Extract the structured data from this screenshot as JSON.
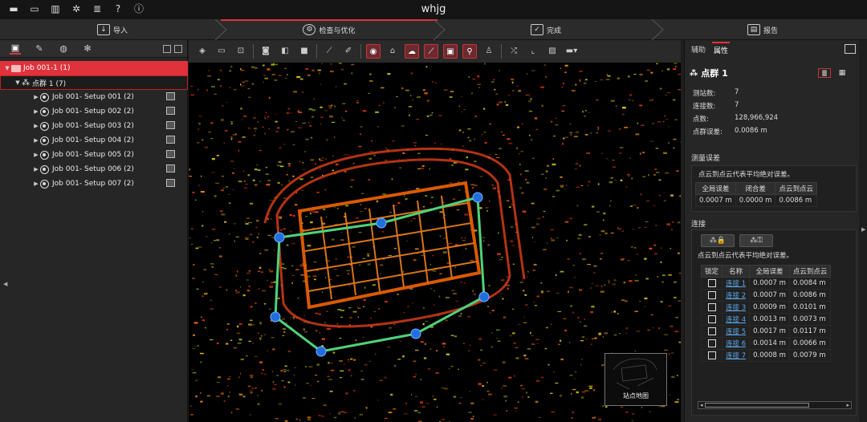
{
  "app": {
    "title": "whjg"
  },
  "titlebar_icons": [
    "folder-icon",
    "archive-icon",
    "panel-icon",
    "gear-icon",
    "database-icon",
    "help-icon",
    "info-icon"
  ],
  "workflow": {
    "steps": [
      {
        "label": "导入",
        "icon": "import-icon"
      },
      {
        "label": "检查与优化",
        "icon": "inspect-icon",
        "active": true
      },
      {
        "label": "完成",
        "icon": "finish-icon"
      },
      {
        "label": "报告",
        "icon": "report-icon"
      }
    ]
  },
  "tree": {
    "job": "Job 001-1 (1)",
    "cloud": "点群 1 (7)",
    "setups": [
      "Job 001- Setup 001 (2)",
      "Job 001- Setup 002 (2)",
      "Job 001- Setup 003 (2)",
      "Job 001- Setup 004 (2)",
      "Job 001- Setup 005 (2)",
      "Job 001- Setup 006 (2)",
      "Job 001- Setup 007 (2)"
    ]
  },
  "minimap": {
    "label": "站点地图"
  },
  "right_panel": {
    "tabs": [
      "辅助",
      "属性"
    ],
    "header": "点群 1",
    "stats": [
      {
        "k": "测站数:",
        "v": "7"
      },
      {
        "k": "连接数:",
        "v": "7"
      },
      {
        "k": "点数:",
        "v": "128,966,924"
      },
      {
        "k": "点群误差:",
        "v": "0.0086 m"
      }
    ],
    "measure_section": "测量误差",
    "measure_note": "点云到点云代表平均绝对误差。",
    "measure_headers": [
      "全局误差",
      "闭合差",
      "点云到点云"
    ],
    "measure_values": [
      "0.0007 m",
      "0.0000 m",
      "0.0086 m"
    ],
    "conn_section": "连接",
    "conn_note": "点云到点云代表平均绝对误差。",
    "conn_headers": [
      "锁定",
      "名称",
      "全局误差",
      "点云到点云"
    ],
    "connections": [
      {
        "name": "连接 1",
        "global": "0.0007 m",
        "c2c": "0.0084 m"
      },
      {
        "name": "连接 2",
        "global": "0.0007 m",
        "c2c": "0.0086 m"
      },
      {
        "name": "连接 3",
        "global": "0.0009 m",
        "c2c": "0.0101 m"
      },
      {
        "name": "连接 4",
        "global": "0.0013 m",
        "c2c": "0.0073 m"
      },
      {
        "name": "连接 5",
        "global": "0.0017 m",
        "c2c": "0.0117 m"
      },
      {
        "name": "连接 6",
        "global": "0.0014 m",
        "c2c": "0.0066 m"
      },
      {
        "name": "连接 7",
        "global": "0.0008 m",
        "c2c": "0.0079 m"
      }
    ]
  },
  "colors": {
    "accent": "#e0323b",
    "link": "#5aa7e8",
    "network_line": "#4fd27a",
    "station": "#1f6fe0"
  }
}
